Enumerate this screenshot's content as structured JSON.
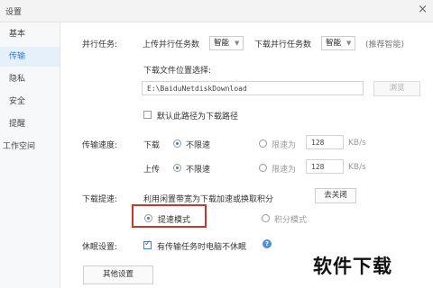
{
  "window": {
    "title": "设置",
    "close_glyph": "×"
  },
  "sidebar": {
    "items": [
      {
        "label": "基本",
        "active": false
      },
      {
        "label": "传输",
        "active": true
      },
      {
        "label": "隐私",
        "active": false
      },
      {
        "label": "安全",
        "active": false
      },
      {
        "label": "提醒",
        "active": false
      },
      {
        "label": "工作空间",
        "active": false
      }
    ]
  },
  "tasks": {
    "label": "并行任务:",
    "upload_label": "上传并行任务数",
    "upload_value": "智能",
    "download_label": "下载并行任务数",
    "download_value": "智能",
    "hint": "(推荐智能)"
  },
  "location": {
    "label": "下载文件位置选择:",
    "path": "E:\\BaiduNetdiskDownload",
    "browse": "浏览",
    "default_label": "默认此路径为下载路径",
    "default_checked": false
  },
  "speed": {
    "label": "传输速度:",
    "download_label": "下载",
    "upload_label": "上传",
    "unlimited": "不限速",
    "limited": "限速为",
    "download_limit": "128",
    "upload_limit": "128",
    "unit": "KB/s"
  },
  "boost": {
    "label": "下载提速:",
    "desc": "利用闲置带宽为下载加速或换取积分",
    "close_button": "去关闭",
    "mode_speed": "提速模式",
    "mode_points": "积分模式"
  },
  "sleep": {
    "label": "休眠设置:",
    "option": "有传输任务时电脑不休眠",
    "checked": true,
    "info_glyph": "?"
  },
  "other_settings": "其他设置",
  "watermark": "软件下载"
}
